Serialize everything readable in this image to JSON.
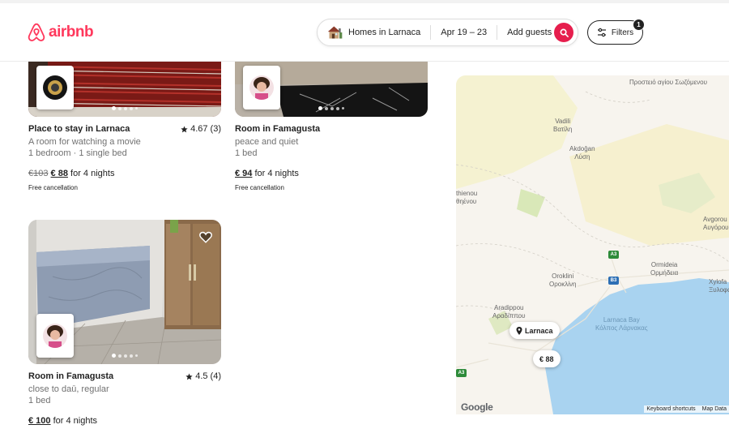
{
  "brand": {
    "name": "airbnb",
    "color": "#ff385c"
  },
  "search": {
    "location": "Homes in Larnaca",
    "dates": "Apr 19 – 23",
    "guests": "Add guests",
    "button_color": "#e61e4d"
  },
  "filters": {
    "label": "Filters",
    "count": "1"
  },
  "listings": [
    {
      "title": "Place to stay in Larnaca",
      "rating": "4.67 (3)",
      "description": "A room for watching a movie",
      "details": "1 bedroom · 1 single bed",
      "price_original": "€103",
      "price_current": "€ 88",
      "price_period": "for 4 nights",
      "cancellation": "Free cancellation",
      "photo_count": 5,
      "active_photo": 1
    },
    {
      "title": "Room in Famagusta",
      "rating": "",
      "description": "peace and quiet",
      "details": "1 bed",
      "price_original": "",
      "price_current": "€ 94",
      "price_period": "for 4 nights",
      "cancellation": "Free cancellation",
      "photo_count": 5,
      "active_photo": 1
    },
    {
      "title": "Room in Famagusta",
      "rating": "4.5 (4)",
      "description": "close to daū, regular",
      "details": "1 bed",
      "price_original": "",
      "price_current": "€ 100",
      "price_period": "for 4 nights",
      "cancellation": "",
      "photo_count": 5,
      "active_photo": 1
    }
  ],
  "map": {
    "places": [
      {
        "name": "Προστειό\nαγίου Σωζόμενου"
      },
      {
        "name": "Vadili\nΒατίλη"
      },
      {
        "name": "Akdoğan\nΛύση"
      },
      {
        "name": "thienou\nθηένου"
      },
      {
        "name": "Avgorou\nΑυγόρου"
      },
      {
        "name": "Oroklini\nΟροκλίνη"
      },
      {
        "name": "Ormideia\nΟρμήδεια"
      },
      {
        "name": "Xylofa\nΞυλοφά"
      },
      {
        "name": "Aradippou\nΑραδίππου"
      },
      {
        "name": "Larnaca Bay\nΚόλπος Λάρνακας"
      }
    ],
    "location_pin": "Larnaca",
    "price_pin": "€ 88",
    "roads": [
      "A3",
      "B3",
      "A3"
    ],
    "attribution": "Google",
    "keyboard_shortcuts": "Keyboard shortcuts",
    "map_data": "Map Data",
    "water_color": "#a9d3f0",
    "land_color": "#f7f4ee"
  }
}
